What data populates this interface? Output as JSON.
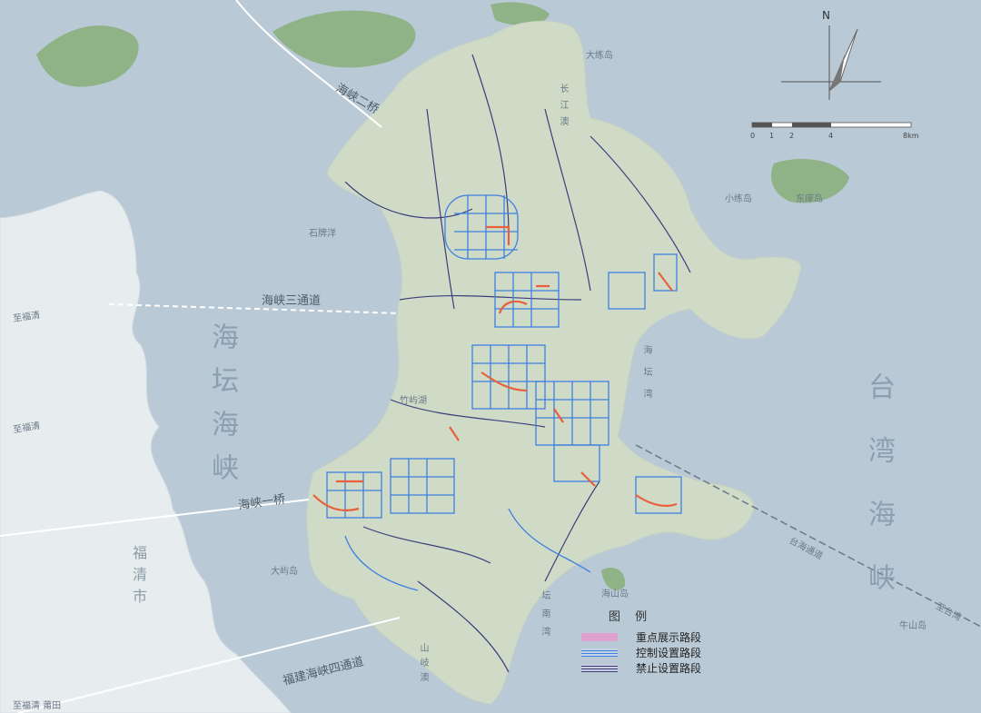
{
  "labels": {
    "sea_taiwan": "台湾海峡",
    "sea_haitan": "海坛海峡",
    "city_fuqing": "福清市",
    "bridge_1": "海峡一桥",
    "bridge_2": "海峡二桥",
    "bridge_3": "海峡三通道",
    "bridge_4": "福建海峡四通道",
    "to_fuqing_1": "至福清",
    "to_fuqing_2": "至福清",
    "to_fuqing_putian": "至福清  莆田",
    "taiwan_channel": "台海通道",
    "to_taiwan": "至台湾",
    "bay_changjiang": "长江澳",
    "bay_haitan": "海坛湾",
    "bay_tannan": "坛南湾",
    "bay_shanqi": "山岐澳",
    "island_dalian": "大练岛",
    "island_xiaolian": "小练岛",
    "island_dongxiang": "东庠岛",
    "island_shilian": "石牌洋",
    "island_da": "大屿岛",
    "island_nianshan": "牛山岛",
    "island_haishan": "海山岛",
    "place_jinjing": "竹屿湖"
  },
  "compass": {
    "north": "N"
  },
  "scale": {
    "ticks": [
      "0",
      "1",
      "2",
      "4",
      "8km"
    ]
  },
  "legend": {
    "title": "图 例",
    "items": [
      {
        "label": "重点展示路段",
        "color": "#e59acb"
      },
      {
        "label": "控制设置路段",
        "color": "#3f7fe0"
      },
      {
        "label": "禁止设置路段",
        "color": "#3a3f7a"
      }
    ]
  }
}
